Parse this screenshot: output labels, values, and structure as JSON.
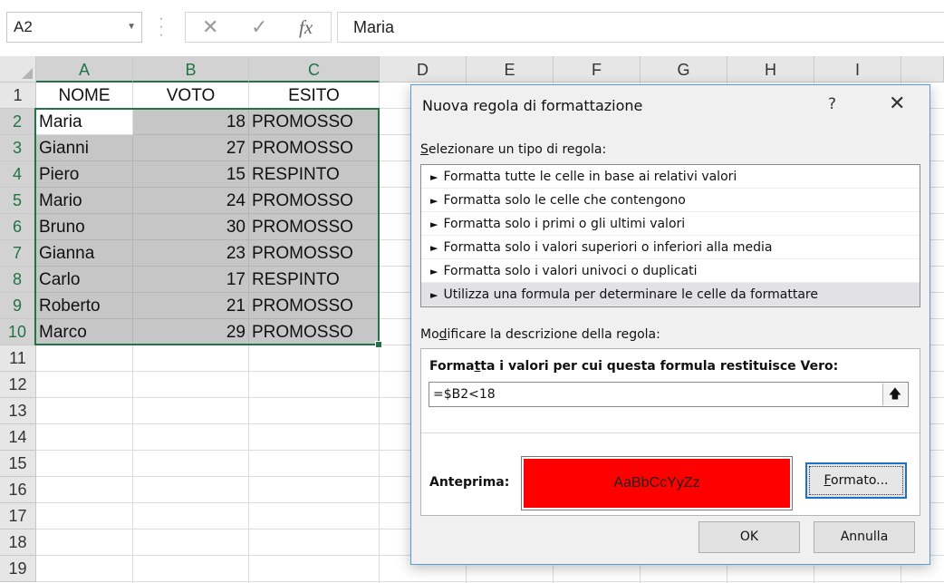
{
  "formula_bar": {
    "name_box": "A2",
    "cancel_symbol": "✕",
    "enter_symbol": "✓",
    "fx_symbol": "fx",
    "content": "Maria"
  },
  "sheet": {
    "columns": [
      "A",
      "B",
      "C",
      "D",
      "E",
      "F",
      "G",
      "H",
      "I"
    ],
    "rows": [
      "1",
      "2",
      "3",
      "4",
      "5",
      "6",
      "7",
      "8",
      "9",
      "10",
      "11",
      "12",
      "13",
      "14",
      "15",
      "16",
      "17",
      "18",
      "19"
    ],
    "headers": [
      "NOME",
      "VOTO",
      "ESITO"
    ],
    "data": [
      {
        "nome": "Maria",
        "voto": "18",
        "esito": "PROMOSSO"
      },
      {
        "nome": "Gianni",
        "voto": "27",
        "esito": "PROMOSSO"
      },
      {
        "nome": "Piero",
        "voto": "15",
        "esito": "RESPINTO"
      },
      {
        "nome": "Mario",
        "voto": "24",
        "esito": "PROMOSSO"
      },
      {
        "nome": "Bruno",
        "voto": "30",
        "esito": "PROMOSSO"
      },
      {
        "nome": "Gianna",
        "voto": "23",
        "esito": "PROMOSSO"
      },
      {
        "nome": "Carlo",
        "voto": "17",
        "esito": "RESPINTO"
      },
      {
        "nome": "Roberto",
        "voto": "21",
        "esito": "PROMOSSO"
      },
      {
        "nome": "Marco",
        "voto": "29",
        "esito": "PROMOSSO"
      }
    ],
    "selection_color": "#217346",
    "highlight_color": "#c6c6c6"
  },
  "dialog": {
    "title": "Nuova regola di formattazione",
    "help": "?",
    "close": "✕",
    "select_type_label_u": "S",
    "select_type_label_rest": "elezionare un tipo di regola:",
    "rule_types": [
      "Formatta tutte le celle in base ai relativi valori",
      "Formatta solo le celle che contengono",
      "Formatta solo i primi o gli ultimi valori",
      "Formatta solo i valori superiori o inferiori alla media",
      "Formatta solo i valori univoci o duplicati",
      "Utilizza una formula per determinare le celle da formattare"
    ],
    "active_rule_index": 5,
    "edit_desc_label_pre": "Mo",
    "edit_desc_label_u": "d",
    "edit_desc_label_post": "ificare la descrizione della regola:",
    "formula_label_pre": "Forma",
    "formula_label_u": "t",
    "formula_label_post": "ta i valori per cui questa formula restituisce Vero:",
    "formula_value": "=$B2<18",
    "collapse_icon": "🡅",
    "preview_label": "Anteprima:",
    "preview_text": "AaBbCcYyZz",
    "preview_fill": "#ff0000",
    "format_button_u": "F",
    "format_button_rest": "ormato...",
    "ok_label": "OK",
    "cancel_label": "Annulla"
  }
}
